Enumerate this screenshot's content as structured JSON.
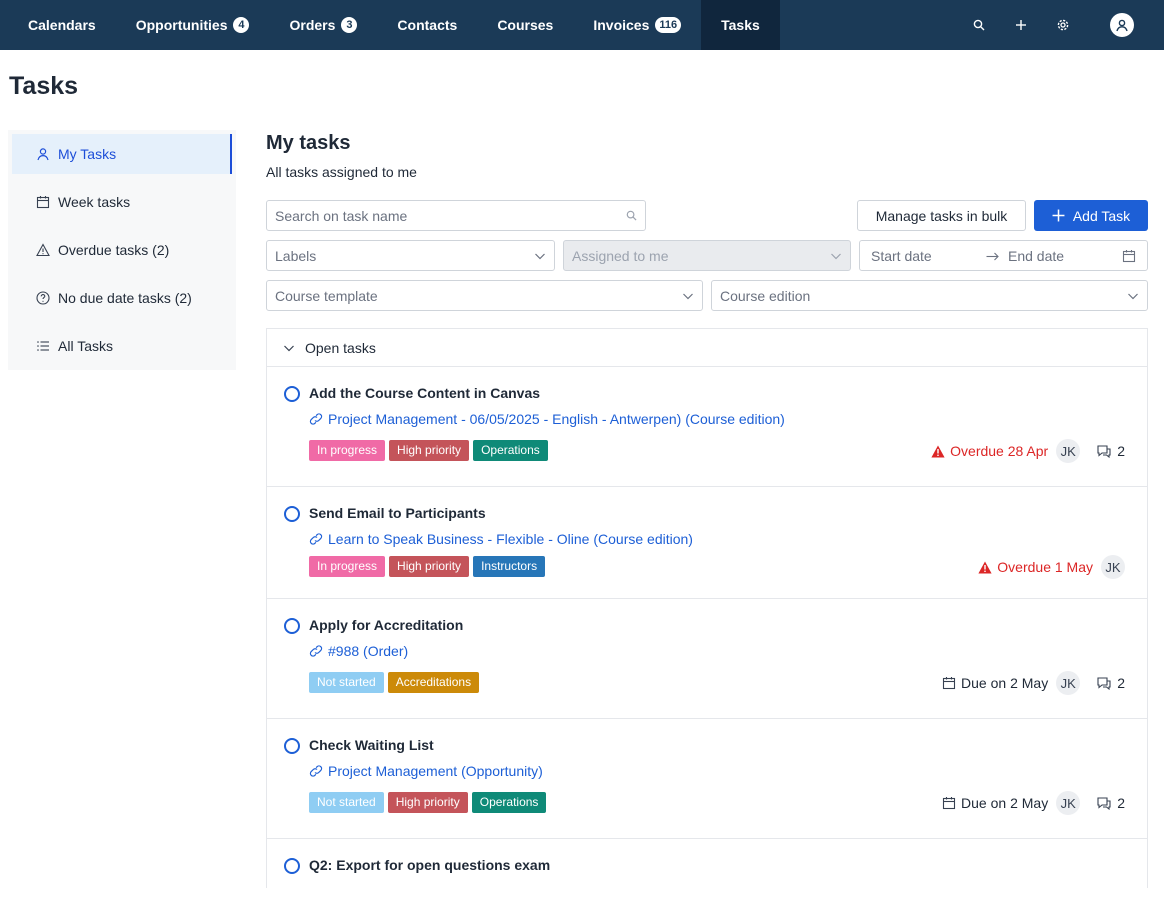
{
  "nav": {
    "items": [
      {
        "label": "Calendars",
        "badge": ""
      },
      {
        "label": "Opportunities",
        "badge": "4"
      },
      {
        "label": "Orders",
        "badge": "3"
      },
      {
        "label": "Contacts",
        "badge": ""
      },
      {
        "label": "Courses",
        "badge": ""
      },
      {
        "label": "Invoices",
        "badge": "116"
      },
      {
        "label": "Tasks",
        "badge": ""
      }
    ],
    "active": "Tasks",
    "icons": [
      "search-icon",
      "plus-icon",
      "gear-icon",
      "user-icon"
    ]
  },
  "page": {
    "title": "Tasks"
  },
  "sidebar": {
    "items": [
      {
        "label": "My Tasks",
        "icon": "user-icon"
      },
      {
        "label": "Week tasks",
        "icon": "calendar-icon"
      },
      {
        "label": "Overdue tasks (2)",
        "icon": "warning-icon"
      },
      {
        "label": "No due date tasks (2)",
        "icon": "question-icon"
      },
      {
        "label": "All Tasks",
        "icon": "list-icon"
      }
    ]
  },
  "main": {
    "heading": "My tasks",
    "subheading": "All tasks assigned to me",
    "search_placeholder": "Search on task name",
    "manage_bulk": "Manage tasks in bulk",
    "add_task": "Add Task",
    "filters": {
      "labels": "Labels",
      "assigned": "Assigned to me",
      "start_date": "Start date",
      "end_date": "End date",
      "course_template": "Course template",
      "course_edition": "Course edition"
    },
    "section": "Open tasks"
  },
  "colors": {
    "nav_bg": "#1b3a57",
    "primary": "#1d5fd6",
    "in_progress": "#f06aa6",
    "high_priority": "#c4545a",
    "operations": "#0f8a78",
    "instructors": "#2776b8",
    "not_started": "#8fcdf3",
    "accreditations": "#cc8a09",
    "overdue": "#dc2626"
  },
  "tasks": [
    {
      "title": "Add the Course Content in Canvas",
      "link": "Project Management - 06/05/2025 - English - Antwerpen) (Course edition)",
      "tags": [
        {
          "label": "In progress",
          "color": "#f06aa6"
        },
        {
          "label": "High priority",
          "color": "#c4545a"
        },
        {
          "label": "Operations",
          "color": "#0f8a78"
        }
      ],
      "due_type": "overdue",
      "due": "Overdue 28 Apr",
      "assignee": "JK",
      "comments": "2"
    },
    {
      "title": "Send Email to Participants",
      "link": "Learn to Speak Business - Flexible - Oline (Course edition)",
      "tags": [
        {
          "label": "In progress",
          "color": "#f06aa6"
        },
        {
          "label": "High priority",
          "color": "#c4545a"
        },
        {
          "label": "Instructors",
          "color": "#2776b8"
        }
      ],
      "due_type": "overdue",
      "due": "Overdue 1 May",
      "assignee": "JK",
      "comments": ""
    },
    {
      "title": "Apply for Accreditation",
      "link": "#988 (Order)",
      "tags": [
        {
          "label": "Not started",
          "color": "#8fcdf3"
        },
        {
          "label": "Accreditations",
          "color": "#cc8a09"
        }
      ],
      "due_type": "due",
      "due": "Due on 2 May",
      "assignee": "JK",
      "comments": "2"
    },
    {
      "title": "Check Waiting List",
      "link": "Project Management (Opportunity)",
      "tags": [
        {
          "label": "Not started",
          "color": "#8fcdf3"
        },
        {
          "label": "High priority",
          "color": "#c4545a"
        },
        {
          "label": "Operations",
          "color": "#0f8a78"
        }
      ],
      "due_type": "due",
      "due": "Due on 2 May",
      "assignee": "JK",
      "comments": "2"
    },
    {
      "title": "Q2: Export for open questions exam",
      "link": "",
      "tags": [],
      "due_type": "",
      "due": "",
      "assignee": "",
      "comments": ""
    }
  ]
}
